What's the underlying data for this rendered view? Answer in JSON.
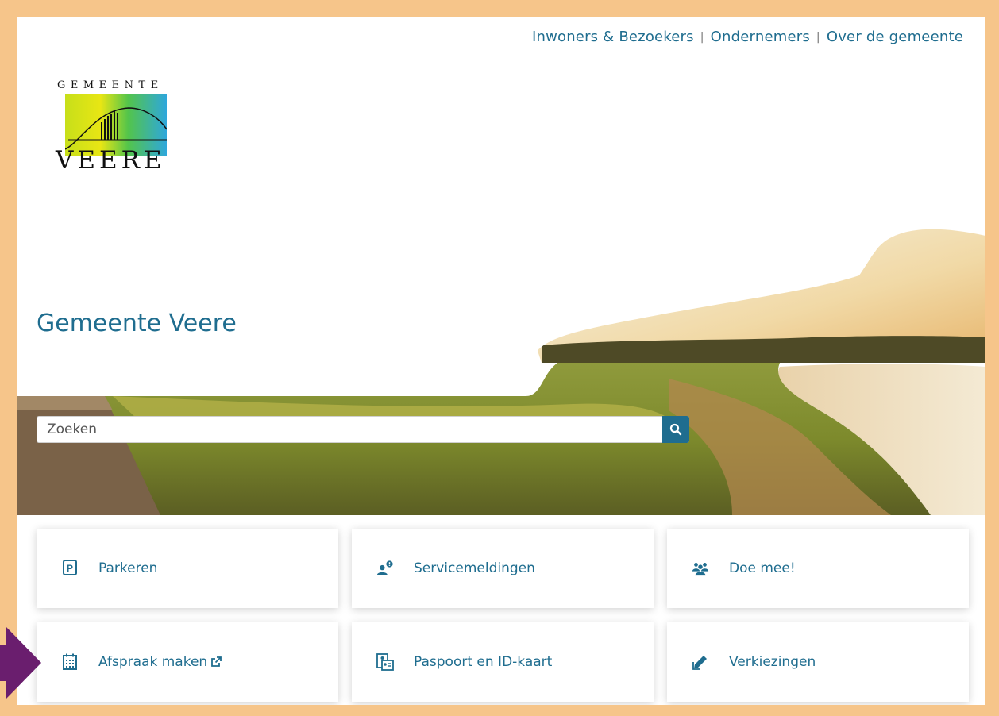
{
  "topnav": {
    "items": [
      "Inwoners & Bezoekers",
      "Ondernemers",
      "Over de gemeente"
    ],
    "separator": "|"
  },
  "logo": {
    "top_word": "GEMEENTE",
    "bottom_word": "VEERE"
  },
  "hero": {
    "title": "Gemeente Veere"
  },
  "search": {
    "placeholder": "Zoeken",
    "value": ""
  },
  "tiles": [
    {
      "label": "Parkeren",
      "icon": "parking-icon"
    },
    {
      "label": "Servicemeldingen",
      "icon": "service-report-icon"
    },
    {
      "label": "Doe mee!",
      "icon": "group-icon"
    },
    {
      "label": "Afspraak maken",
      "icon": "calendar-icon",
      "external": true
    },
    {
      "label": "Paspoort en ID-kaart",
      "icon": "id-card-icon"
    },
    {
      "label": "Verkiezingen",
      "icon": "pencil-icon"
    }
  ],
  "colors": {
    "primary": "#1f6d8f",
    "frame": "#f6c58a",
    "arrow": "#6a1e6e"
  }
}
